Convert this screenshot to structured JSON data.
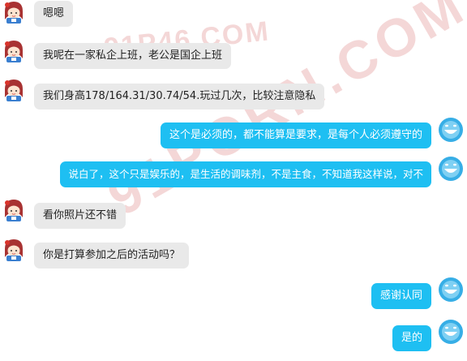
{
  "colors": {
    "incoming_bubble": "#e9e9e9",
    "outgoing_bubble": "#1ebff2",
    "background": "#ffffff"
  },
  "watermark": {
    "top": "91P46.COM",
    "diagonal": "91PORN.COM"
  },
  "messages": [
    {
      "side": "in",
      "avatar": "girl-avatar-icon",
      "text": "嗯嗯"
    },
    {
      "side": "in",
      "avatar": "girl-avatar-icon",
      "text": "我呢在一家私企上班，老公是国企上班"
    },
    {
      "side": "in",
      "avatar": "girl-avatar-icon",
      "text": "我们身高178/164.31/30.74/54.玩过几次，比较注意隐私"
    },
    {
      "side": "out",
      "avatar": "smiley-avatar-icon",
      "text": "这个是必须的，都不能算是要求，是每个人必须遵守的"
    },
    {
      "side": "out",
      "avatar": "smiley-avatar-icon",
      "text": "说白了，这个只是娱乐的，是生活的调味剂，不是主食，不知道我这样说，对不"
    },
    {
      "side": "in",
      "avatar": "girl-avatar-icon",
      "text": "看你照片还不错"
    },
    {
      "side": "in",
      "avatar": "girl-avatar-icon",
      "text": "你是打算参加之后的活动吗？"
    },
    {
      "side": "out",
      "avatar": "smiley-avatar-icon",
      "text": "感谢认同"
    },
    {
      "side": "out",
      "avatar": "smiley-avatar-icon",
      "text": "是的"
    }
  ]
}
